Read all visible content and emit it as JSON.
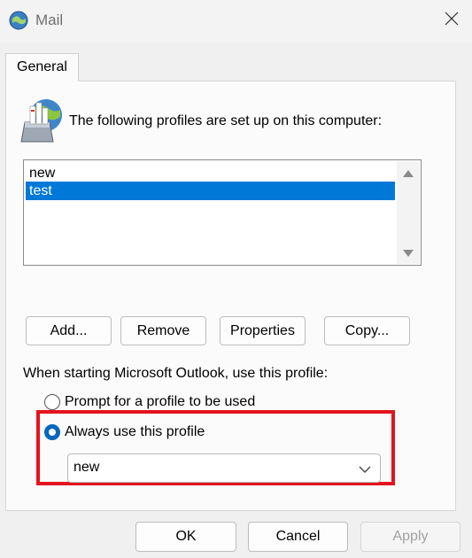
{
  "window": {
    "title": "Mail",
    "app_icon": "mail-globe-icon",
    "close_icon": "close-icon"
  },
  "tabs": [
    {
      "label": "General",
      "active": true
    }
  ],
  "profiles": {
    "heading": "The following profiles are set up on this computer:",
    "icon": "profiles-server-icon",
    "items": [
      {
        "label": "new",
        "selected": false
      },
      {
        "label": "test",
        "selected": true
      }
    ]
  },
  "actions": {
    "add": "Add...",
    "remove": "Remove",
    "properties": "Properties",
    "copy": "Copy..."
  },
  "startup": {
    "label": "When starting Microsoft Outlook, use this profile:",
    "options": [
      {
        "label": "Prompt for a profile to be used",
        "checked": false
      },
      {
        "label": "Always use this profile",
        "checked": true
      }
    ],
    "selected_profile": "new"
  },
  "footer": {
    "ok": "OK",
    "cancel": "Cancel",
    "apply": "Apply",
    "apply_enabled": false
  },
  "colors": {
    "selection": "#0078d7",
    "radio_checked": "#0067c0",
    "highlight": "#e3141e"
  }
}
